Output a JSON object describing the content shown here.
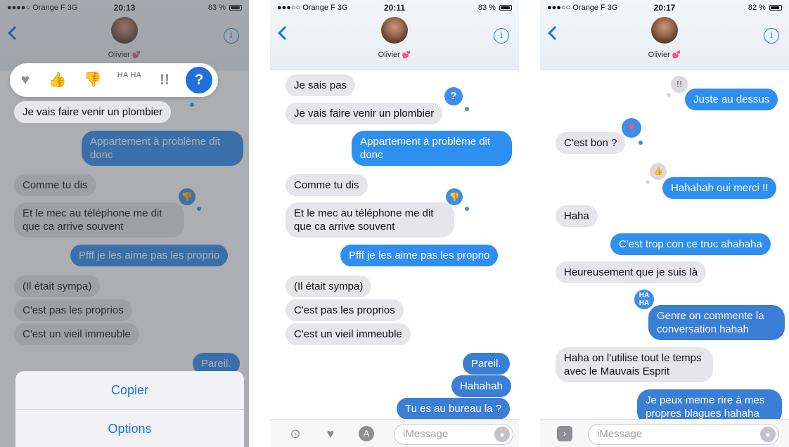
{
  "screen1": {
    "status": {
      "carrier": "●●●●○ Orange F  3G",
      "time": "20:13",
      "battery": "83 %"
    },
    "contact_name": "Olivier",
    "tapback_options": [
      "♥",
      "👍",
      "👎",
      "HA HA",
      "!!",
      "?"
    ],
    "messages": [
      "Je vais faire venir un plombier",
      "Appartement à problème dit donc",
      "Comme tu dis",
      "Et le mec au téléphone me dit que ca arrive souvent",
      "Pfff je les aime pas les proprio",
      "(Il était sympa)",
      "C'est pas les proprios",
      "C'est un vieil immeuble",
      "Pareil."
    ],
    "actions": {
      "copy": "Copier",
      "options": "Options"
    }
  },
  "screen2": {
    "status": {
      "carrier": "●●●○○ Orange F  3G",
      "time": "20:11",
      "battery": "83 %"
    },
    "contact_name": "Olivier",
    "messages": [
      "Je sais pas",
      "Je vais faire venir un plombier",
      "Appartement à problème dit donc",
      "Comme tu dis",
      "Et le mec au téléphone me dit que ca arrive souvent",
      "Pfff je les aime pas les proprio",
      "(Il était sympa)",
      "C'est pas les proprios",
      "C'est un vieil immeuble",
      "Pareil.",
      "Hahahah",
      "Tu es au bureau la ?"
    ],
    "input_placeholder": "iMessage"
  },
  "screen3": {
    "status": {
      "carrier": "●●●○○ Orange F  3G",
      "time": "20:17",
      "battery": "82 %"
    },
    "contact_name": "Olivier",
    "messages": [
      "Juste au dessus",
      "C'est bon ?",
      "Hahahah oui merci !!",
      "Haha",
      "C'est trop con ce truc ahahaha",
      "Heureusement que je suis là",
      "Genre on commente la conversation hahah",
      "Haha on l'utilise tout le temps avec le Mauvais Esprit",
      "Je peux meme rire à mes propres blagues hahaha"
    ],
    "input_placeholder": "iMessage"
  },
  "colors": {
    "accent": "#1a73e8",
    "outgoing": "#2e8ff0",
    "incoming": "#e5e5ea",
    "tapback": "#3f8de5"
  }
}
